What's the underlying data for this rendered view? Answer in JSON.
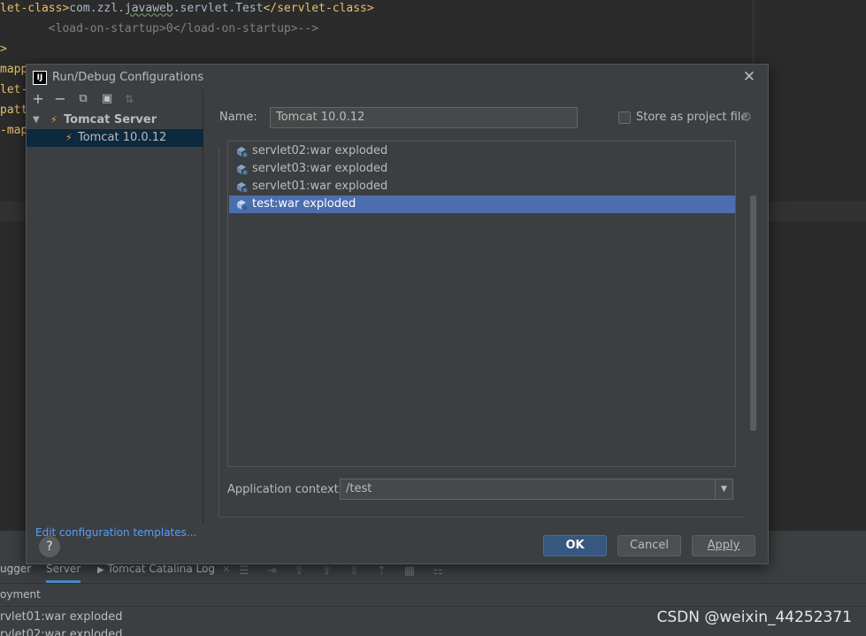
{
  "editor": {
    "lines": [
      {
        "parts": [
          {
            "t": "let-class>",
            "c": "tag"
          },
          {
            "t": "com.zzl.",
            "c": "txt"
          },
          {
            "t": "javaweb",
            "c": "txt underline-wave"
          },
          {
            "t": ".servlet.Test",
            "c": "txt"
          },
          {
            "t": "</servlet-class>",
            "c": "tag"
          }
        ]
      },
      {
        "parts": [
          {
            "t": "       <load-on-startup>0</load-on-startup>-->",
            "c": "comment"
          }
        ]
      },
      {
        "parts": [
          {
            "t": ">",
            "c": "tag"
          }
        ]
      },
      {
        "parts": [
          {
            "t": "mapp",
            "c": "tag"
          }
        ]
      },
      {
        "parts": [
          {
            "t": "let-",
            "c": "tag"
          }
        ]
      },
      {
        "parts": [
          {
            "t": "patt",
            "c": "tag"
          }
        ]
      },
      {
        "parts": [
          {
            "t": "-map",
            "c": "tag"
          }
        ]
      }
    ]
  },
  "bottom_panel": {
    "tabs": [
      "ugger",
      "Server",
      "Tomcat Catalina Log"
    ],
    "active_tab": "Server",
    "subheader": "oyment",
    "rows": [
      "rvlet01:war exploded",
      "rvlet02:war exploded"
    ]
  },
  "watermark": "CSDN @weixin_44252371",
  "dialog": {
    "title": "Run/Debug Configurations",
    "logo_text": "IJ",
    "close_icon": "✕",
    "toolbar_icons": [
      "+",
      "−",
      "⧉",
      "▣",
      "⇅"
    ],
    "tree": {
      "group": "Tomcat Server",
      "child": "Tomcat 10.0.12"
    },
    "edit_templates_link": "Edit configuration templates...",
    "name_label": "Name:",
    "name_value": "Tomcat 10.0.12",
    "store_label": "Store as project file",
    "store_checked": false,
    "artifacts": [
      {
        "label": "servlet02:war exploded",
        "selected": false
      },
      {
        "label": "servlet03:war exploded",
        "selected": false
      },
      {
        "label": "servlet01:war exploded",
        "selected": false
      },
      {
        "label": "test:war exploded",
        "selected": true
      }
    ],
    "context_label": "Application context:",
    "context_value": "/test",
    "buttons": {
      "ok": "OK",
      "cancel": "Cancel",
      "apply": "Apply",
      "help": "?"
    },
    "colors": {
      "accent": "#4b6eaf",
      "primary_button": "#365880",
      "link": "#589df6"
    }
  }
}
